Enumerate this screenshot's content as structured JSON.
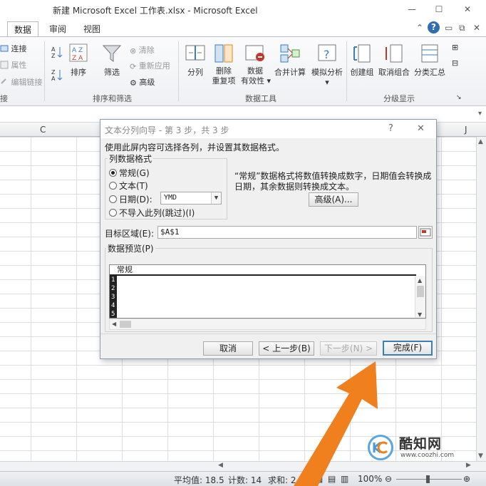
{
  "window": {
    "title": "新建 Microsoft Excel 工作表.xlsx - Microsoft Excel",
    "minimize": "—",
    "maximize": "☐",
    "close": "✕"
  },
  "ribbon": {
    "tabs": [
      {
        "label": "数据",
        "active": true
      },
      {
        "label": "审阅",
        "active": false
      },
      {
        "label": "视图",
        "active": false
      }
    ],
    "connections": {
      "connect": "连接",
      "properties": "属性",
      "edit_links": "编辑链接",
      "group_label_partial": "接"
    },
    "sort_filter": {
      "sort": "排序",
      "filter": "筛选",
      "clear": "清除",
      "reapply": "重新应用",
      "advanced": "高级",
      "group_label": "排序和筛选"
    },
    "data_tools": {
      "text_to_columns": "分列",
      "remove_duplicates_line1": "删除",
      "remove_duplicates_line2": "重复项",
      "data_validation_line1": "数据",
      "data_validation_line2": "有效性",
      "consolidate": "合并计算",
      "what_if": "模拟分析",
      "group_label": "数据工具"
    },
    "outline": {
      "group": "创建组",
      "ungroup": "取消组合",
      "subtotal": "分类汇总",
      "group_label": "分级显示"
    }
  },
  "sheet": {
    "col_c": "C",
    "col_j": "J"
  },
  "dialog": {
    "title": "文本分列向导 - 第 3 步，共 3 步",
    "help": "?",
    "close": "✕",
    "instruction": "使用此屏内容可选择各列，并设置其数据格式。",
    "format_legend": "列数据格式",
    "formats": [
      {
        "label": "常规(G)",
        "checked": true
      },
      {
        "label": "文本(T)",
        "checked": false
      },
      {
        "label": "日期(D):",
        "checked": false
      },
      {
        "label": "不导入此列(跳过)(I)",
        "checked": false
      }
    ],
    "date_format": "YMD",
    "description": "“常规”数据格式将数值转换成数字，日期值会转换成日期，其余数据则转换成文本。",
    "advanced_button": "高级(A)...",
    "destination_label": "目标区域(E):",
    "destination_value": "$A$1",
    "preview_legend": "数据预览(P)",
    "preview_header": "常规",
    "preview_rows": [
      "1",
      "2",
      "3",
      "4",
      "5"
    ],
    "buttons": {
      "cancel": "取消",
      "back": "< 上一步(B)",
      "next": "下一步(N) >",
      "finish": "完成(F)"
    }
  },
  "statusbar": {
    "average": "平均值: 18.5",
    "count": "计数: 14",
    "sum": "求和: 2",
    "zoom": "100%"
  },
  "watermark": {
    "name": "酷知网",
    "url": "www.coozhi.com"
  },
  "colors": {
    "arrow": "#f07f1e",
    "default_button_border": "#3c7fb1"
  }
}
